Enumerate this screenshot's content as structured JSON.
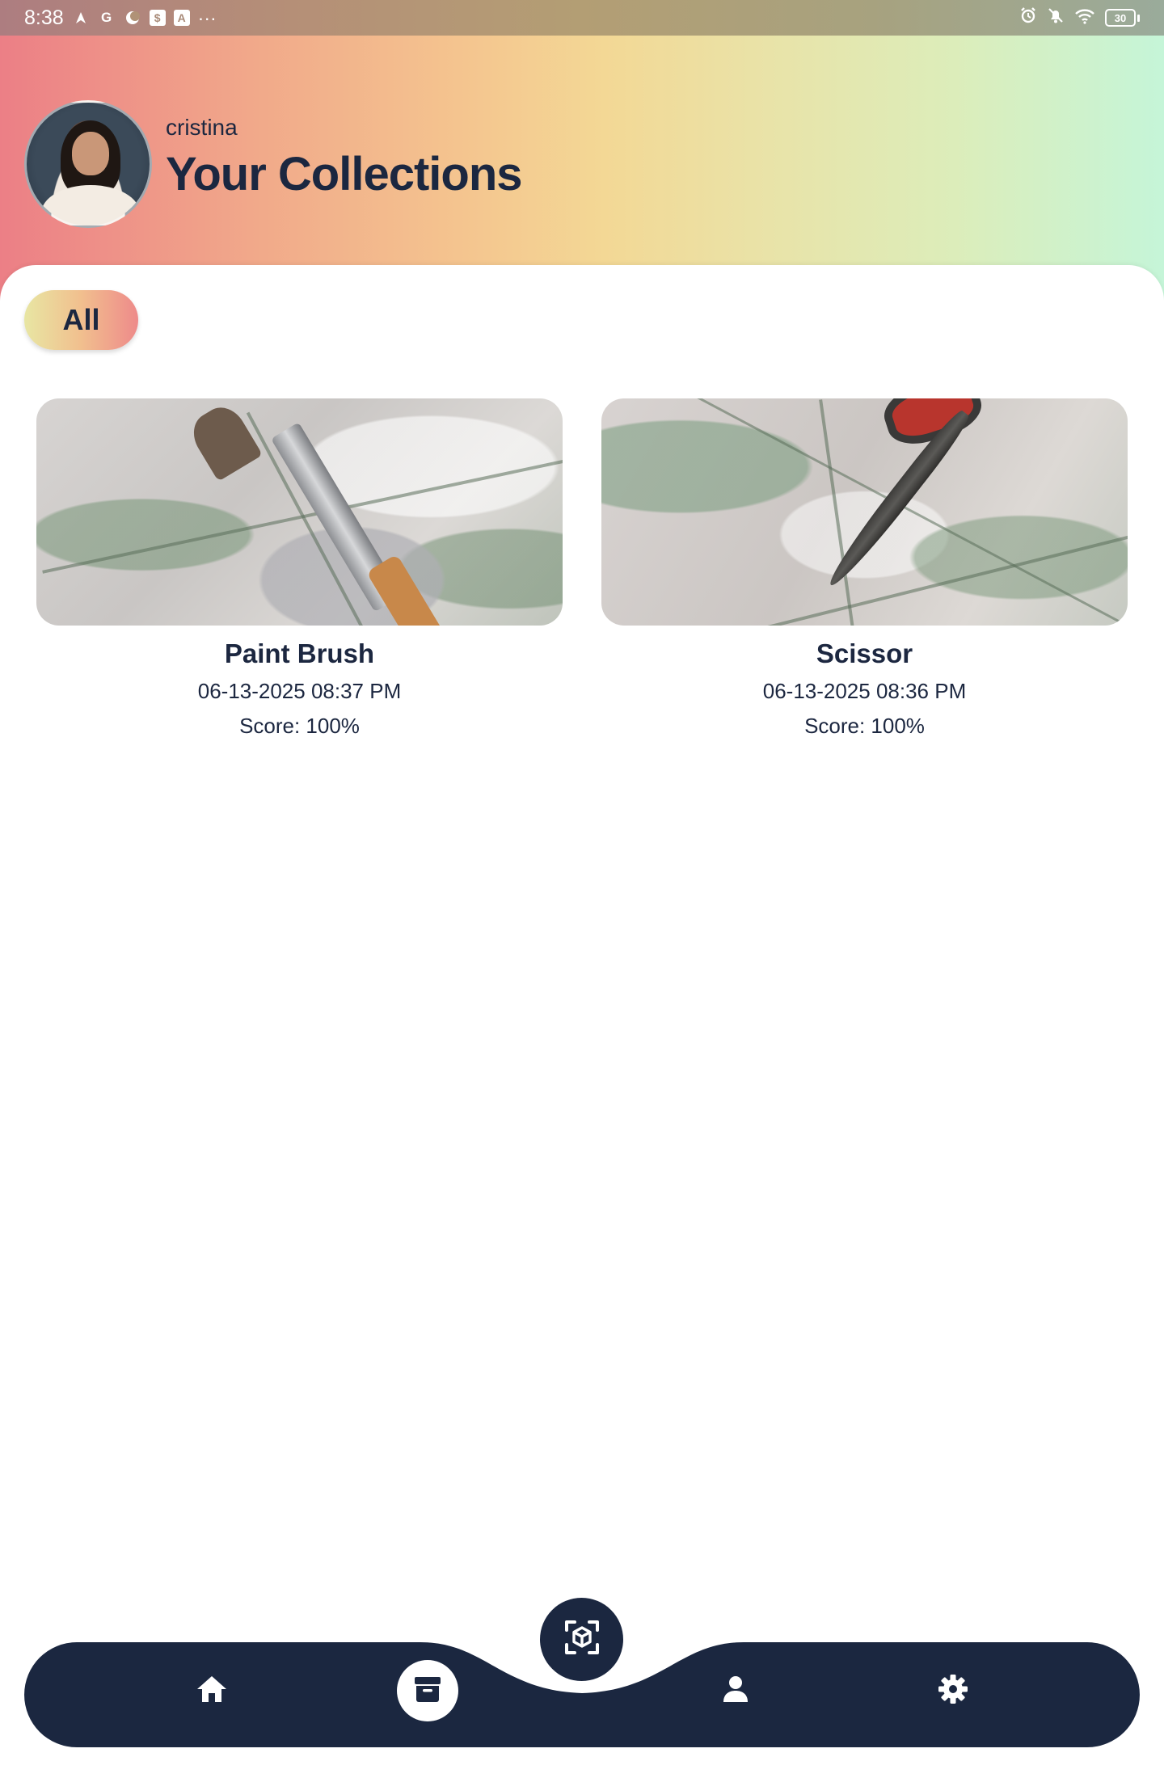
{
  "status_bar": {
    "time": "8:38",
    "notification_icons": [
      "navigation-icon",
      "google-icon",
      "moon-icon",
      "shopping-bag-icon",
      "app-icon"
    ],
    "overflow": "···",
    "right_icons": [
      "alarm-icon",
      "muted-bell-icon",
      "wifi-icon"
    ],
    "battery": "30"
  },
  "header": {
    "username": "cristina",
    "title": "Your Collections"
  },
  "filters": {
    "active": "All"
  },
  "collections": [
    {
      "name": "Paint Brush",
      "date": "06-13-2025 08:37 PM",
      "score": "Score: 100%"
    },
    {
      "name": "Scissor",
      "date": "06-13-2025 08:36 PM",
      "score": "Score: 100%"
    }
  ],
  "bottom_nav": {
    "items": [
      {
        "icon": "home-icon"
      },
      {
        "icon": "archive-box-icon",
        "active": true
      },
      {
        "icon": "scan-cube-icon"
      },
      {
        "icon": "person-icon"
      },
      {
        "icon": "gear-icon"
      }
    ],
    "bar_color": "#1b2740"
  },
  "colors": {
    "accent_dark": "#1b2740",
    "gradient_start": "#ec7f86",
    "gradient_mid": "#f3d895",
    "gradient_end": "#c5f5d8"
  }
}
